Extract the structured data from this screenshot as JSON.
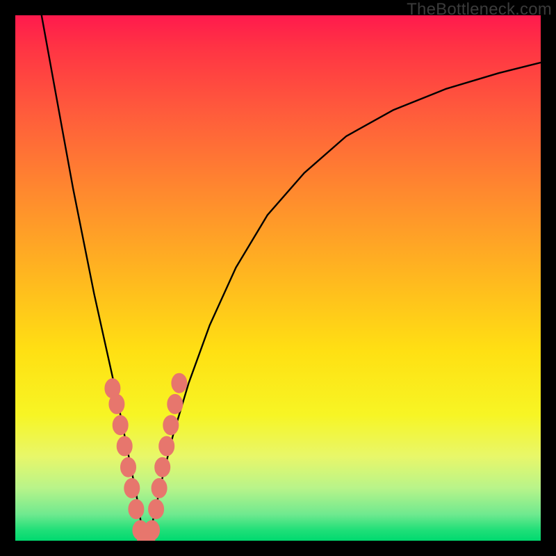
{
  "watermark": "TheBottleneck.com",
  "chart_data": {
    "type": "line",
    "title": "",
    "xlabel": "",
    "ylabel": "",
    "xlim": [
      0,
      100
    ],
    "ylim": [
      0,
      100
    ],
    "grid": false,
    "legend": false,
    "series": [
      {
        "name": "bottleneck-curve",
        "x": [
          5,
          7,
          9,
          11,
          13,
          15,
          17,
          19,
          20,
          21,
          22,
          23,
          24,
          25,
          26,
          28,
          30,
          33,
          37,
          42,
          48,
          55,
          63,
          72,
          82,
          92,
          100
        ],
        "y": [
          100,
          89,
          78,
          67,
          57,
          47,
          38,
          29,
          24,
          19,
          14,
          9,
          3,
          0,
          3,
          12,
          20,
          30,
          41,
          52,
          62,
          70,
          77,
          82,
          86,
          89,
          91
        ]
      }
    ],
    "markers": {
      "name": "highlight-points",
      "color": "#e7766d",
      "points": [
        {
          "x": 18.5,
          "y": 29
        },
        {
          "x": 19.3,
          "y": 26
        },
        {
          "x": 20.0,
          "y": 22
        },
        {
          "x": 20.8,
          "y": 18
        },
        {
          "x": 21.5,
          "y": 14
        },
        {
          "x": 22.2,
          "y": 10
        },
        {
          "x": 23.0,
          "y": 6
        },
        {
          "x": 23.8,
          "y": 2
        },
        {
          "x": 25.0,
          "y": 0
        },
        {
          "x": 26.0,
          "y": 2
        },
        {
          "x": 26.8,
          "y": 6
        },
        {
          "x": 27.4,
          "y": 10
        },
        {
          "x": 28.0,
          "y": 14
        },
        {
          "x": 28.8,
          "y": 18
        },
        {
          "x": 29.6,
          "y": 22
        },
        {
          "x": 30.4,
          "y": 26
        },
        {
          "x": 31.2,
          "y": 30
        }
      ]
    },
    "background_gradient": {
      "top": "#ff1a4d",
      "mid": "#ffe013",
      "bottom": "#00d96f"
    }
  }
}
